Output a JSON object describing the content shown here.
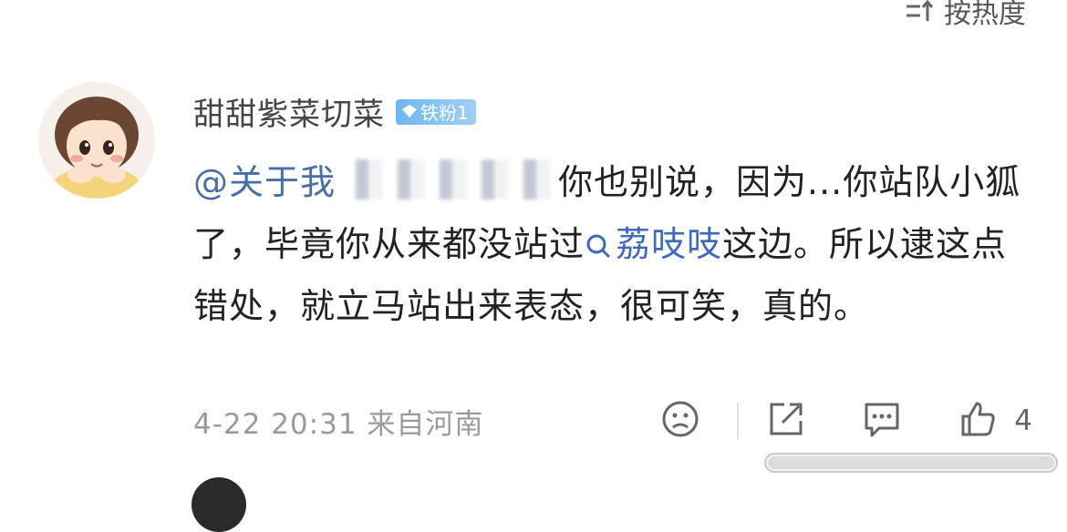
{
  "sort": {
    "label": "按热度"
  },
  "comment": {
    "username": "甜甜紫菜切菜",
    "badge": "铁粉1",
    "mention": "@关于我",
    "text_after_mention": "你也别说，因为...你站队小狐了，毕竟你从来都没站过",
    "topic": "荔吱吱",
    "text_after_topic": "这边。所以逮这点错处，就立马站出来表态，很可笑，真的。",
    "meta": "4-22 20:31 来自河南",
    "like_count": "4"
  },
  "colors": {
    "mention": "#4a6ea9",
    "topic": "#3d6ac1",
    "badge": "#6fb6f4",
    "meta": "#9a9a9a"
  },
  "icons": [
    "sort-icon",
    "search-icon",
    "dislike-face-icon",
    "share-icon",
    "comment-icon",
    "thumbs-up-icon"
  ]
}
